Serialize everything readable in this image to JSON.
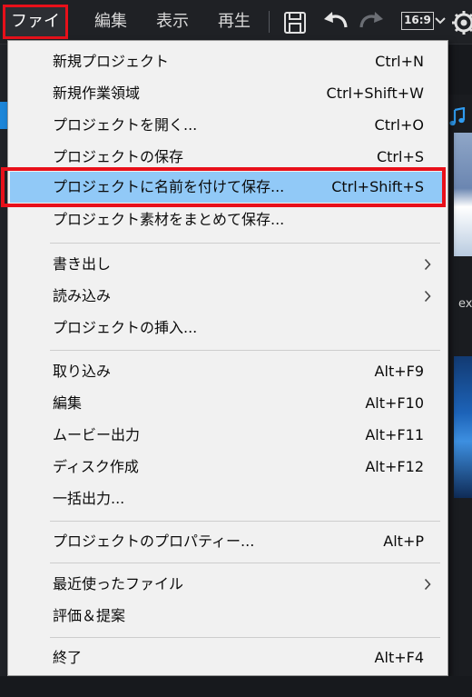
{
  "menubar": {
    "file": "ファイル",
    "edit": "編集",
    "view": "表示",
    "play": "再生",
    "aspect_ratio": "16:9"
  },
  "background": {
    "peek_text": "ex"
  },
  "file_menu": {
    "new_project": {
      "label": "新規プロジェクト",
      "shortcut": "Ctrl+N"
    },
    "new_workspace": {
      "label": "新規作業領域",
      "shortcut": "Ctrl+Shift+W"
    },
    "open_project": {
      "label": "プロジェクトを開く...",
      "shortcut": "Ctrl+O"
    },
    "save_project": {
      "label": "プロジェクトの保存",
      "shortcut": "Ctrl+S"
    },
    "save_project_as": {
      "label": "プロジェクトに名前を付けて保存...",
      "shortcut": "Ctrl+Shift+S"
    },
    "pack_project": {
      "label": "プロジェクト素材をまとめて保存..."
    },
    "export": {
      "label": "書き出し"
    },
    "import": {
      "label": "読み込み"
    },
    "insert_project": {
      "label": "プロジェクトの挿入..."
    },
    "capture": {
      "label": "取り込み",
      "shortcut": "Alt+F9"
    },
    "edit": {
      "label": "編集",
      "shortcut": "Alt+F10"
    },
    "movie_output": {
      "label": "ムービー出力",
      "shortcut": "Alt+F11"
    },
    "disc_creation": {
      "label": "ディスク作成",
      "shortcut": "Alt+F12"
    },
    "batch_output": {
      "label": "一括出力..."
    },
    "project_properties": {
      "label": "プロジェクトのプロパティー...",
      "shortcut": "Alt+P"
    },
    "recent_files": {
      "label": "最近使ったファイル"
    },
    "rate_suggest": {
      "label": "評価＆提案"
    },
    "exit": {
      "label": "終了",
      "shortcut": "Alt+F4"
    }
  },
  "colors": {
    "highlight": "#91c9f7",
    "annotation_red": "#e8101a",
    "menu_background": "#f1f1f1",
    "app_background": "#17191d"
  },
  "icons": [
    "save-icon",
    "undo-icon",
    "redo-icon",
    "chevron-down-icon",
    "gear-icon",
    "chevron-right-icon",
    "music-note-icon"
  ]
}
